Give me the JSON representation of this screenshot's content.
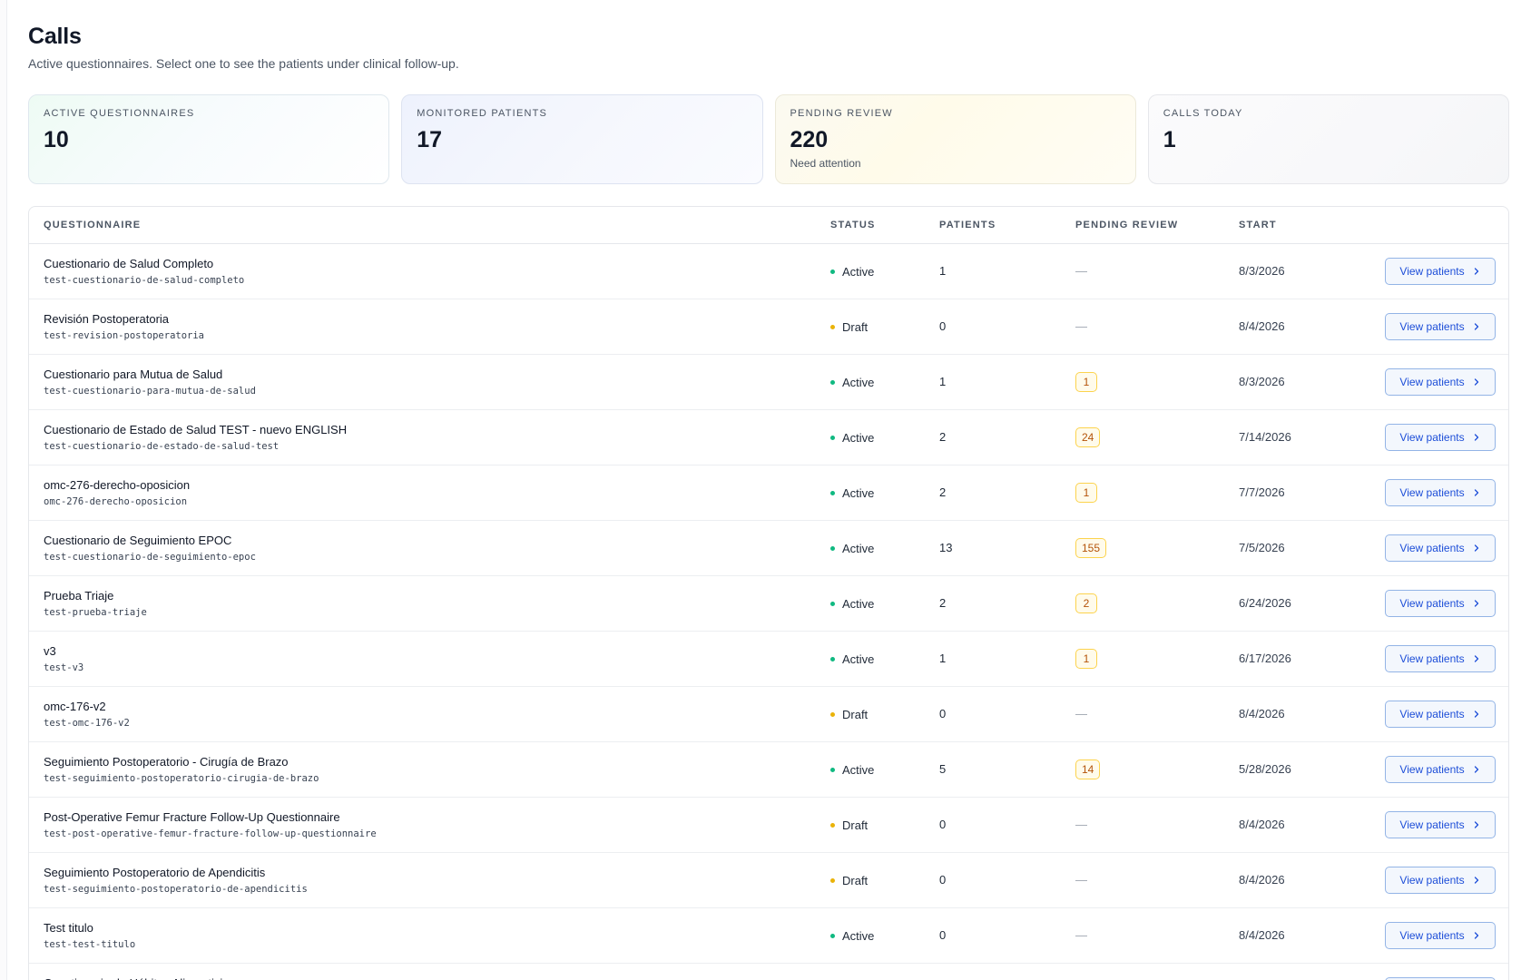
{
  "header": {
    "title": "Calls",
    "subtitle": "Active questionnaires. Select one to see the patients under clinical follow-up."
  },
  "stats": [
    {
      "label": "ACTIVE QUESTIONNAIRES",
      "value": "10",
      "hint": ""
    },
    {
      "label": "MONITORED PATIENTS",
      "value": "17",
      "hint": ""
    },
    {
      "label": "PENDING REVIEW",
      "value": "220",
      "hint": "Need attention"
    },
    {
      "label": "CALLS TODAY",
      "value": "1",
      "hint": ""
    }
  ],
  "table": {
    "headers": {
      "questionnaire": "QUESTIONNAIRE",
      "status": "STATUS",
      "patients": "PATIENTS",
      "pending": "PENDING REVIEW",
      "start": "START"
    },
    "button_label": "View patients",
    "empty_pending": "—",
    "status_colors": {
      "Active": "#10b981",
      "Draft": "#eab308"
    },
    "rows": [
      {
        "title": "Cuestionario de Salud Completo",
        "slug": "test-cuestionario-de-salud-completo",
        "status": "Active",
        "patients": "1",
        "pending": "",
        "start": "8/3/2026"
      },
      {
        "title": "Revisión Postoperatoria",
        "slug": "test-revision-postoperatoria",
        "status": "Draft",
        "patients": "0",
        "pending": "",
        "start": "8/4/2026"
      },
      {
        "title": "Cuestionario para Mutua de Salud",
        "slug": "test-cuestionario-para-mutua-de-salud",
        "status": "Active",
        "patients": "1",
        "pending": "1",
        "start": "8/3/2026"
      },
      {
        "title": "Cuestionario de Estado de Salud TEST - nuevo ENGLISH",
        "slug": "test-cuestionario-de-estado-de-salud-test",
        "status": "Active",
        "patients": "2",
        "pending": "24",
        "start": "7/14/2026"
      },
      {
        "title": "omc-276-derecho-oposicion",
        "slug": "omc-276-derecho-oposicion",
        "status": "Active",
        "patients": "2",
        "pending": "1",
        "start": "7/7/2026"
      },
      {
        "title": "Cuestionario de Seguimiento EPOC",
        "slug": "test-cuestionario-de-seguimiento-epoc",
        "status": "Active",
        "patients": "13",
        "pending": "155",
        "start": "7/5/2026"
      },
      {
        "title": "Prueba Triaje",
        "slug": "test-prueba-triaje",
        "status": "Active",
        "patients": "2",
        "pending": "2",
        "start": "6/24/2026"
      },
      {
        "title": "v3",
        "slug": "test-v3",
        "status": "Active",
        "patients": "1",
        "pending": "1",
        "start": "6/17/2026"
      },
      {
        "title": "omc-176-v2",
        "slug": "test-omc-176-v2",
        "status": "Draft",
        "patients": "0",
        "pending": "",
        "start": "8/4/2026"
      },
      {
        "title": "Seguimiento Postoperatorio - Cirugía de Brazo",
        "slug": "test-seguimiento-postoperatorio-cirugia-de-brazo",
        "status": "Active",
        "patients": "5",
        "pending": "14",
        "start": "5/28/2026"
      },
      {
        "title": "Post-Operative Femur Fracture Follow-Up Questionnaire",
        "slug": "test-post-operative-femur-fracture-follow-up-questionnaire",
        "status": "Draft",
        "patients": "0",
        "pending": "",
        "start": "8/4/2026"
      },
      {
        "title": "Seguimiento Postoperatorio de Apendicitis",
        "slug": "test-seguimiento-postoperatorio-de-apendicitis",
        "status": "Draft",
        "patients": "0",
        "pending": "",
        "start": "8/4/2026"
      },
      {
        "title": "Test titulo",
        "slug": "test-test-titulo",
        "status": "Active",
        "patients": "0",
        "pending": "",
        "start": "8/4/2026"
      },
      {
        "title": "Cuestionario de Hábitos Alimenticios",
        "slug": "",
        "status": "",
        "patients": "",
        "pending": "",
        "start": ""
      }
    ]
  }
}
